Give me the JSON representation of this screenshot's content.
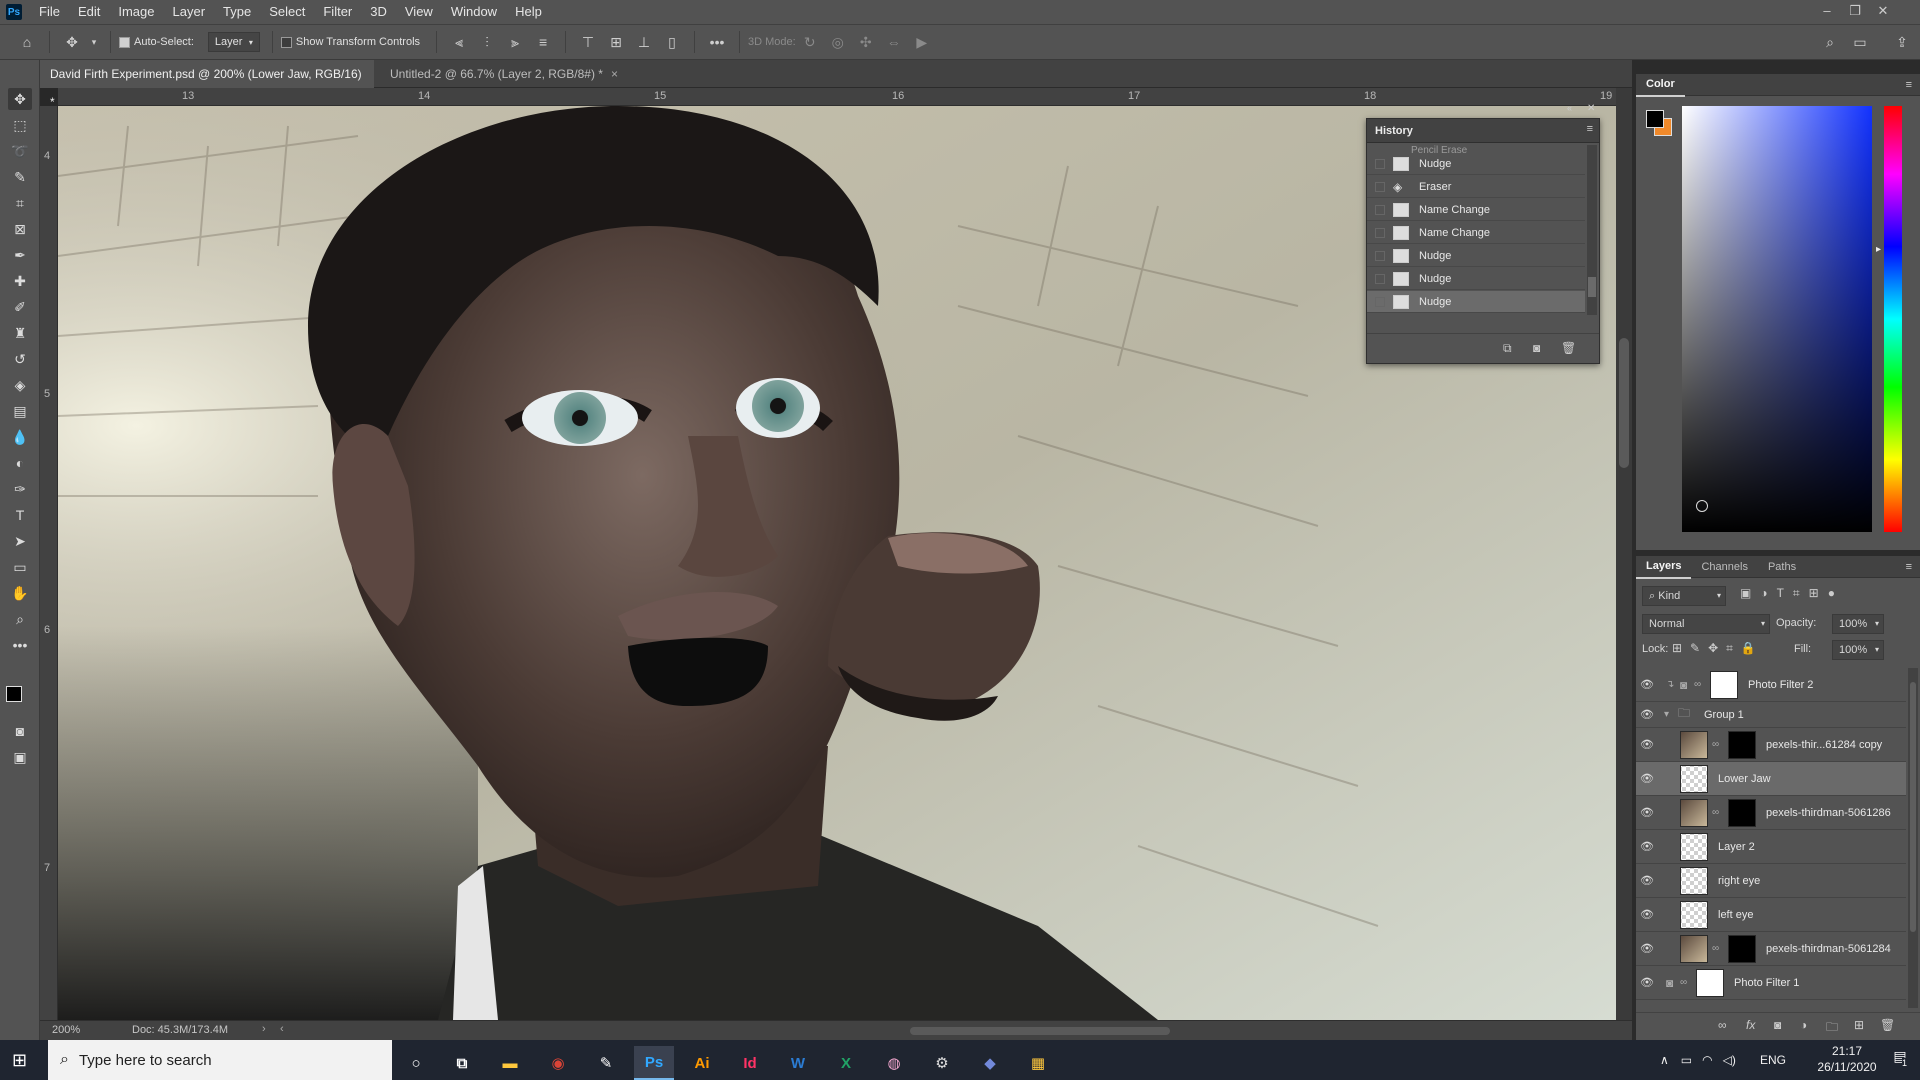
{
  "app": {
    "logo_text": "Ps"
  },
  "menu": [
    "File",
    "Edit",
    "Image",
    "Layer",
    "Type",
    "Select",
    "Filter",
    "3D",
    "View",
    "Window",
    "Help"
  ],
  "options": {
    "auto_select_label": "Auto-Select:",
    "auto_select_value": "Layer",
    "show_transform_label": "Show Transform Controls",
    "mode_3d_label": "3D Mode:"
  },
  "tabs": [
    {
      "label": "David Firth Experiment.psd @ 200% (Lower Jaw, RGB/16) *",
      "active": true
    },
    {
      "label": "Untitled-2 @ 66.7% (Layer 2, RGB/8#) *",
      "active": false
    }
  ],
  "ruler": {
    "h": [
      "13",
      "14",
      "15",
      "16",
      "17",
      "18",
      "19"
    ],
    "v": [
      "4",
      "5",
      "6",
      "7"
    ]
  },
  "status": {
    "zoom": "200%",
    "doc": "Doc: 45.3M/173.4M"
  },
  "history": {
    "title": "History",
    "partial": "Pencil Erase",
    "items": [
      {
        "label": "Nudge",
        "icon": "doc-icon"
      },
      {
        "label": "Eraser",
        "icon": "eraser-icon"
      },
      {
        "label": "Name Change",
        "icon": "doc-icon"
      },
      {
        "label": "Name Change",
        "icon": "doc-icon"
      },
      {
        "label": "Nudge",
        "icon": "doc-icon"
      },
      {
        "label": "Nudge",
        "icon": "doc-icon"
      },
      {
        "label": "Nudge",
        "icon": "doc-icon",
        "selected": true
      }
    ]
  },
  "color_panel": {
    "title": "Color",
    "fg": "#000000",
    "bg": "#f0892a"
  },
  "layers_panel": {
    "tabs": [
      "Layers",
      "Channels",
      "Paths"
    ],
    "kind_label": "Kind",
    "blend_mode": "Normal",
    "opacity_label": "Opacity:",
    "opacity_value": "100%",
    "lock_label": "Lock:",
    "fill_label": "Fill:",
    "fill_value": "100%",
    "layers": [
      {
        "name": "Photo Filter 2",
        "type": "adjustment",
        "indent": false
      },
      {
        "name": "Group 1",
        "type": "group",
        "indent": false
      },
      {
        "name": "pexels-thir...61284 copy",
        "type": "photo-mask",
        "indent": true
      },
      {
        "name": "Lower Jaw",
        "type": "empty",
        "indent": true,
        "selected": true
      },
      {
        "name": "pexels-thirdman-5061286",
        "type": "photo-mask",
        "indent": true
      },
      {
        "name": "Layer 2",
        "type": "empty",
        "indent": true
      },
      {
        "name": "right eye",
        "type": "empty",
        "indent": true
      },
      {
        "name": "left eye",
        "type": "empty",
        "indent": true
      },
      {
        "name": "pexels-thirdman-5061284",
        "type": "photo-mask",
        "indent": true
      },
      {
        "name": "Photo Filter 1",
        "type": "adjustment",
        "indent": false
      }
    ]
  },
  "taskbar": {
    "search_placeholder": "Type here to search",
    "apps": [
      "File Explorer",
      "Chrome",
      "Pen",
      "Ps",
      "Ai",
      "Id",
      "W",
      "X",
      "Camera",
      "Tool",
      "Discord",
      "Store"
    ],
    "lang": "ENG",
    "time": "21:17",
    "date": "26/11/2020",
    "notif_count": "1"
  }
}
